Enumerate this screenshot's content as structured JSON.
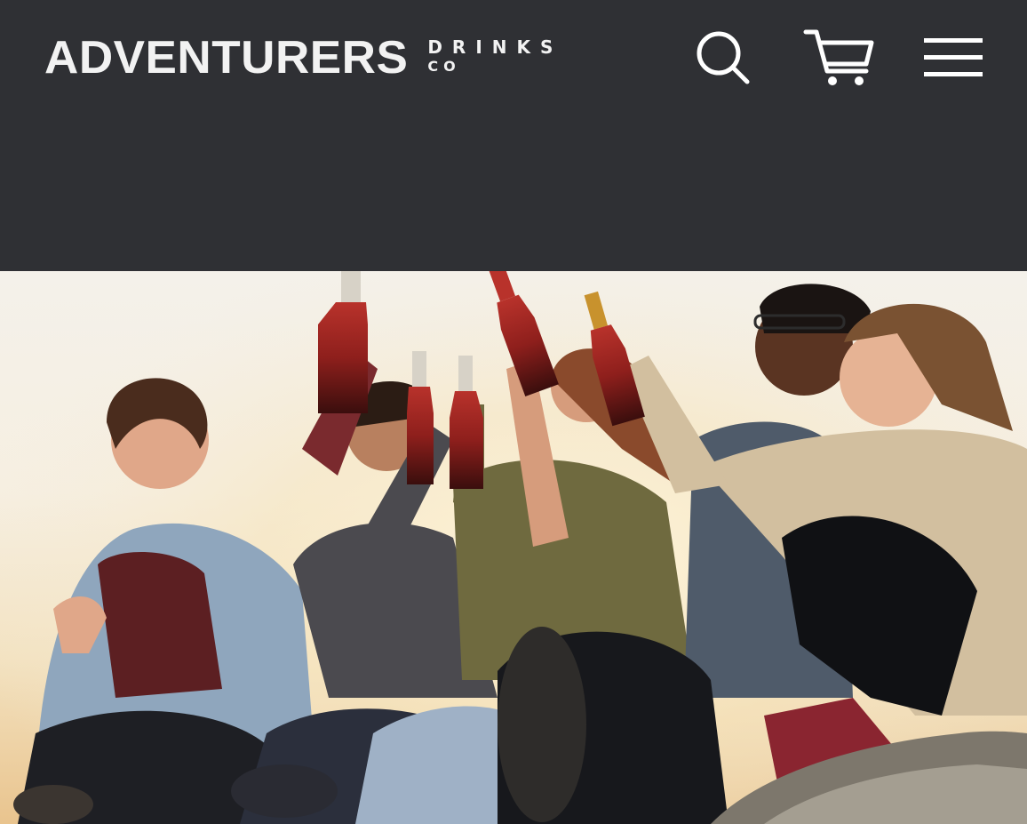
{
  "brand": {
    "name": "ADVENTURERS",
    "sub_line1": "DRINKS",
    "sub_line2": "CO"
  },
  "header": {
    "icons": [
      "search-icon",
      "cart-icon",
      "hamburger-menu-icon"
    ],
    "background": "#2f3034",
    "icon_color": "#ffffff"
  },
  "hero": {
    "image": "group of friends toasting with bottles of red soda at sunset"
  }
}
